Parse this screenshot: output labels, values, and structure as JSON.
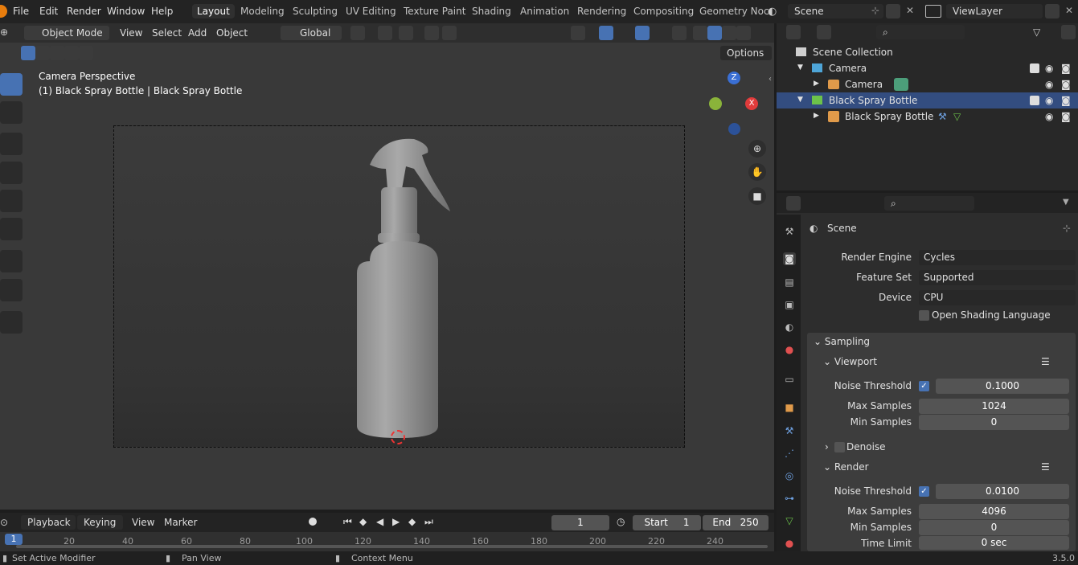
{
  "menus": [
    "File",
    "Edit",
    "Render",
    "Window",
    "Help"
  ],
  "workspaces": [
    "Layout",
    "Modeling",
    "Sculpting",
    "UV Editing",
    "Texture Paint",
    "Shading",
    "Animation",
    "Rendering",
    "Compositing",
    "Geometry Noc"
  ],
  "scene_field": "Scene",
  "viewlayer_field": "ViewLayer",
  "viewport_header": {
    "mode": "Object Mode",
    "menus": [
      "View",
      "Select",
      "Add",
      "Object"
    ],
    "orientation": "Global",
    "options": "Options"
  },
  "viewport_text": {
    "camera_title": "Camera Perspective",
    "object_info": "(1) Black Spray Bottle | Black Spray Bottle"
  },
  "gizmo": {
    "z": "Z",
    "x": "X"
  },
  "outliner": {
    "collection": "Scene Collection",
    "rows": [
      {
        "label": "Camera"
      },
      {
        "label": "Camera"
      },
      {
        "label": "Black Spray Bottle"
      },
      {
        "label": "Black Spray Bottle"
      }
    ]
  },
  "properties": {
    "header": "Scene",
    "render_engine_label": "Render Engine",
    "render_engine": "Cycles",
    "feature_set_label": "Feature Set",
    "feature_set": "Supported",
    "device_label": "Device",
    "device": "CPU",
    "osl_label": "Open Shading Language",
    "sampling": "Sampling",
    "viewport": "Viewport",
    "noise_threshold_label": "Noise Threshold",
    "vp_noise_threshold": "0.1000",
    "max_samples_label": "Max Samples",
    "vp_max_samples": "1024",
    "min_samples_label": "Min Samples",
    "vp_min_samples": "0",
    "denoise": "Denoise",
    "render": "Render",
    "r_noise_threshold": "0.0100",
    "r_max_samples": "4096",
    "r_min_samples": "0",
    "time_limit_label": "Time Limit",
    "r_time_limit": "0 sec"
  },
  "timeline": {
    "menus": [
      "Playback",
      "Keying",
      "View",
      "Marker"
    ],
    "current_frame": "1",
    "start_label": "Start",
    "start": "1",
    "end_label": "End",
    "end": "250",
    "ticks": [
      "1",
      "20",
      "40",
      "60",
      "80",
      "100",
      "120",
      "140",
      "160",
      "180",
      "200",
      "220",
      "240"
    ]
  },
  "status": {
    "left": "Set Active Modifier",
    "middle": "Pan View",
    "right": "Context Menu",
    "version": "3.5.0"
  },
  "colors": {
    "accent": "#4772b3",
    "selected_row": "#334d80",
    "gizmo_x": "#e03b3b",
    "gizmo_y": "#8ab33a",
    "gizmo_z": "#3a6fd4"
  }
}
